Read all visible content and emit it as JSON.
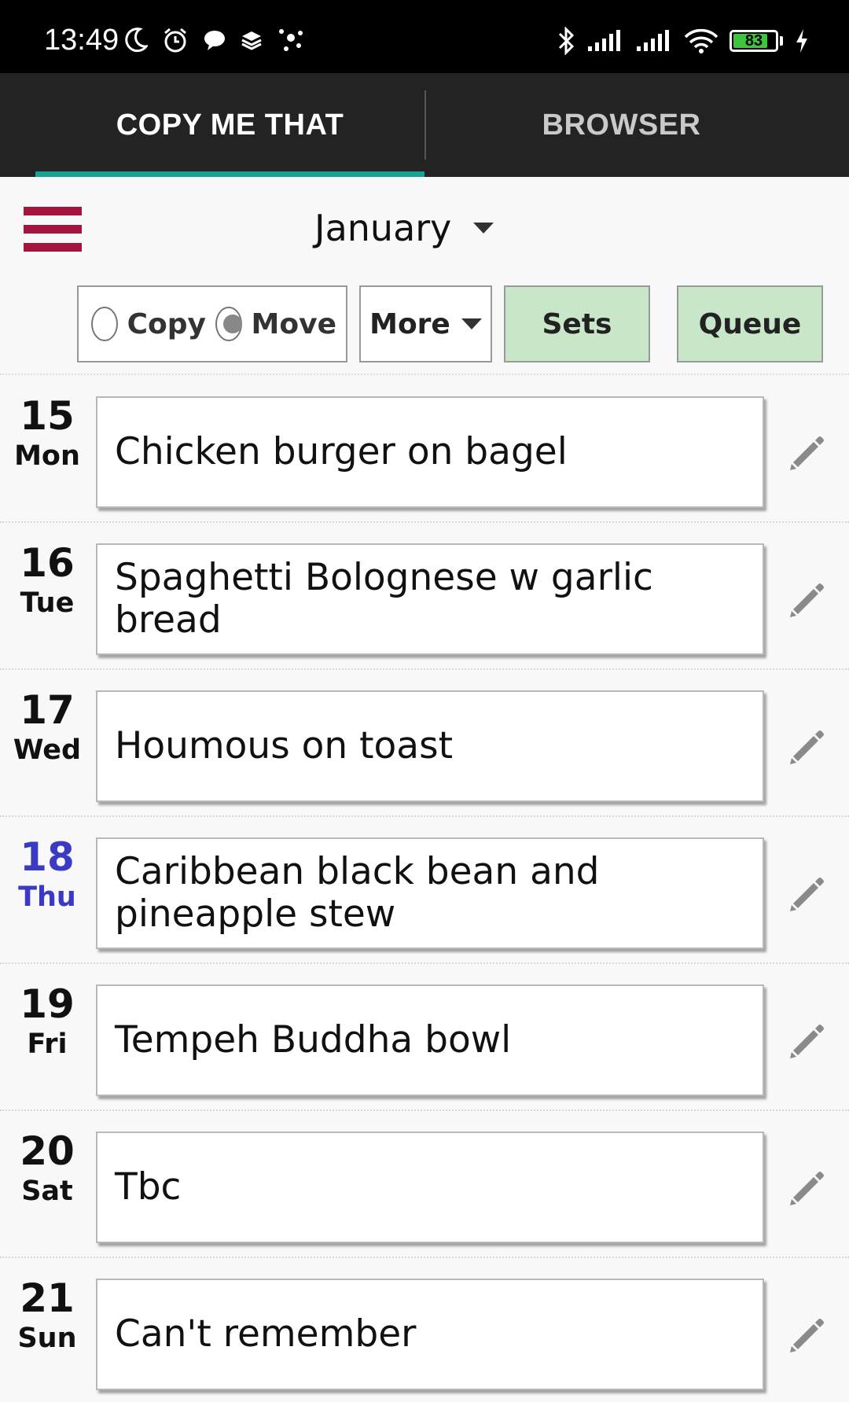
{
  "status_bar": {
    "time": "13:49",
    "battery": "83",
    "battery_level": 0.83,
    "icons": [
      "moon-icon",
      "alarm-icon",
      "chat-icon",
      "stack-icon",
      "dots-icon",
      "bluetooth-icon",
      "signal-icon",
      "signal-icon",
      "wifi-icon",
      "battery-icon",
      "charging-icon"
    ]
  },
  "tabs": [
    {
      "label": "COPY ME THAT",
      "active": true
    },
    {
      "label": "BROWSER",
      "active": false
    }
  ],
  "header": {
    "month": "January"
  },
  "controls": {
    "copy_label": "Copy",
    "move_label": "Move",
    "selected": "Move",
    "more_label": "More",
    "sets_label": "Sets",
    "queue_label": "Queue"
  },
  "colors": {
    "accent": "#16a394",
    "menu": "#a3153f",
    "today": "#3a3ac4",
    "button_green": "#c8e6c8"
  },
  "days": [
    {
      "num": "15",
      "name": "Mon",
      "meal": "Chicken burger on bagel",
      "today": false
    },
    {
      "num": "16",
      "name": "Tue",
      "meal": "Spaghetti Bolognese w garlic bread",
      "today": false
    },
    {
      "num": "17",
      "name": "Wed",
      "meal": "Houmous on toast",
      "today": false
    },
    {
      "num": "18",
      "name": "Thu",
      "meal": "Caribbean black bean and pineapple stew",
      "today": true
    },
    {
      "num": "19",
      "name": "Fri",
      "meal": "Tempeh Buddha bowl",
      "today": false
    },
    {
      "num": "20",
      "name": "Sat",
      "meal": "Tbc",
      "today": false
    },
    {
      "num": "21",
      "name": "Sun",
      "meal": "Can't remember",
      "today": false
    }
  ]
}
